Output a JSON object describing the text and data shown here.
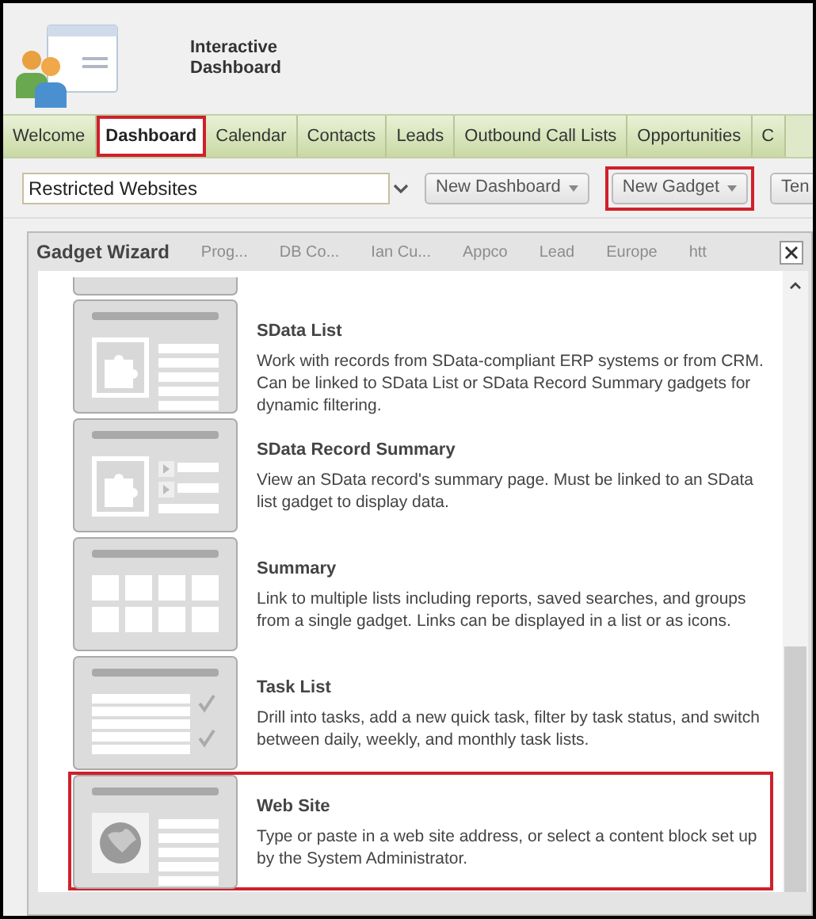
{
  "app": {
    "title_lines": [
      "Interactive",
      "Dashboard"
    ]
  },
  "tabs": [
    {
      "label": "Welcome",
      "selected": false,
      "highlighted": false
    },
    {
      "label": "Dashboard",
      "selected": true,
      "highlighted": true
    },
    {
      "label": "Calendar",
      "selected": false,
      "highlighted": false
    },
    {
      "label": "Contacts",
      "selected": false,
      "highlighted": false
    },
    {
      "label": "Leads",
      "selected": false,
      "highlighted": false
    },
    {
      "label": "Outbound Call Lists",
      "selected": false,
      "highlighted": false
    },
    {
      "label": "Opportunities",
      "selected": false,
      "highlighted": false
    },
    {
      "label": "C",
      "selected": false,
      "highlighted": false
    }
  ],
  "toolbar": {
    "dashboard_select": {
      "value": "Restricted Websites"
    },
    "buttons": [
      {
        "label": "New Dashboard",
        "highlighted": false
      },
      {
        "label": "New Gadget",
        "highlighted": true
      },
      {
        "label": "Ten",
        "highlighted": false
      }
    ]
  },
  "background_columns": [
    "Prog...",
    "DB Co...",
    "Ian Cu...",
    "Appco",
    "Lead",
    "Europe",
    "htt"
  ],
  "dialog": {
    "title": "Gadget Wizard",
    "gadgets": [
      {
        "kind": "list",
        "title": "SData List",
        "description": "Work with records from SData-compliant ERP systems or from CRM. Can be linked to SData List or SData Record Summary gadgets for dynamic filtering.",
        "highlighted": false
      },
      {
        "kind": "record",
        "title": "SData Record Summary",
        "description": "View an SData record's summary page. Must be linked to an SData list gadget to display data.",
        "highlighted": false
      },
      {
        "kind": "grid",
        "title": "Summary",
        "description": "Link to multiple lists including reports, saved searches, and groups from a single gadget. Links can be displayed in a list or as icons.",
        "highlighted": false
      },
      {
        "kind": "tasks",
        "title": "Task List",
        "description": "Drill into tasks, add a new quick task, filter by task status, and switch between daily, weekly, and monthly task lists.",
        "highlighted": false
      },
      {
        "kind": "web",
        "title": "Web Site",
        "description": "Type or paste in a web site address, or select a content block set up by the System Administrator.",
        "highlighted": true
      }
    ]
  }
}
